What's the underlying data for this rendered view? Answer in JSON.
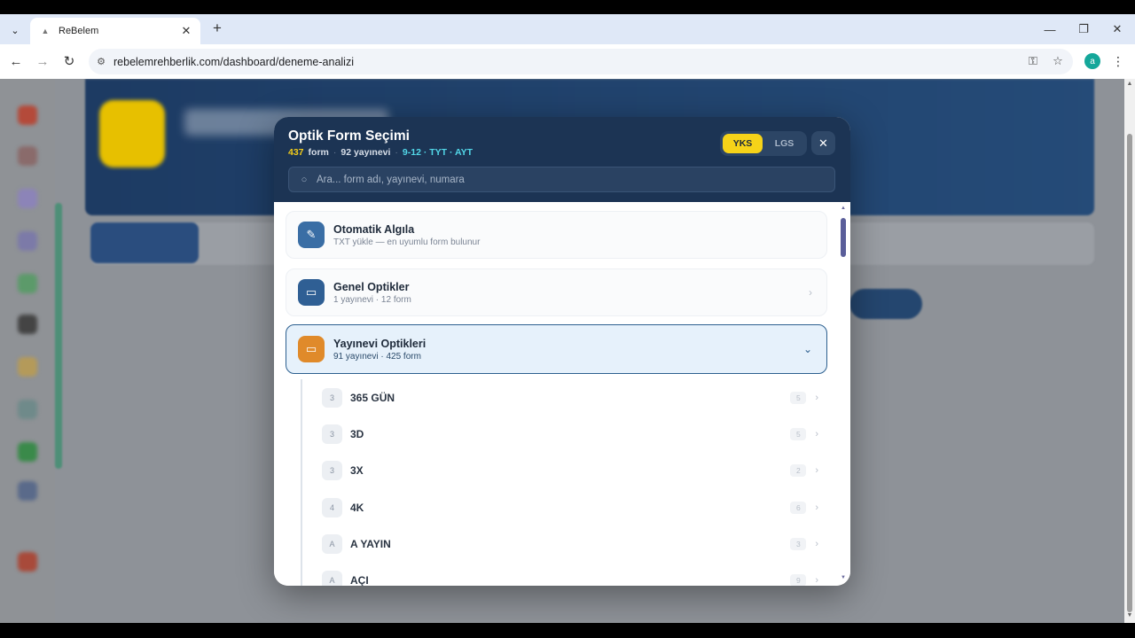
{
  "browser": {
    "tab_title": "ReBelem",
    "url": "rebelemrehberlik.com/dashboard/deneme-analizi",
    "profile_initial": "a",
    "icons": [
      "tab-search-icon",
      "new-tab-icon",
      "minimize-icon",
      "restore-icon",
      "close-window-icon",
      "back-icon",
      "forward-icon",
      "reload-icon",
      "site-info-icon",
      "password-key-icon",
      "bookmark-star-icon",
      "menu-kebab-icon"
    ]
  },
  "modal": {
    "title": "Optik Form Seçimi",
    "meta": {
      "form_count": "437",
      "form_label": "form",
      "publisher_text": "92 yayınevi",
      "grade_text": "9-12 · TYT · AYT"
    },
    "exam_toggle": {
      "options": [
        "YKS",
        "LGS"
      ],
      "selected": "YKS"
    },
    "search": {
      "placeholder": "Ara... form adı, yayınevi, numara",
      "value": ""
    },
    "cards": {
      "auto": {
        "title": "Otomatik Algıla",
        "subtitle": "TXT yükle — en uyumlu form bulunur",
        "icon": "pen-icon",
        "color": "#3a6ea5"
      },
      "general": {
        "title": "Genel Optikler",
        "subtitle": "1 yayınevi · 12 form",
        "icon": "folder-icon",
        "color": "#2f5f94"
      },
      "publisher": {
        "title": "Yayınevi Optikleri",
        "subtitle": "91 yayınevi · 425 form",
        "icon": "folder-icon",
        "color": "#e08a2a",
        "expanded": true
      }
    },
    "publishers": [
      {
        "badge": "3",
        "name": "365 GÜN",
        "count": "5"
      },
      {
        "badge": "3",
        "name": "3D",
        "count": "5"
      },
      {
        "badge": "3",
        "name": "3X",
        "count": "2"
      },
      {
        "badge": "4",
        "name": "4K",
        "count": "6"
      },
      {
        "badge": "A",
        "name": "A YAYIN",
        "count": "3"
      },
      {
        "badge": "A",
        "name": "AÇI",
        "count": "9"
      }
    ]
  },
  "colors": {
    "header_bg": "#1c3454",
    "accent_yellow": "#f6d319",
    "accent_cyan": "#52d7e8",
    "selected_border": "#2c5f8f"
  }
}
